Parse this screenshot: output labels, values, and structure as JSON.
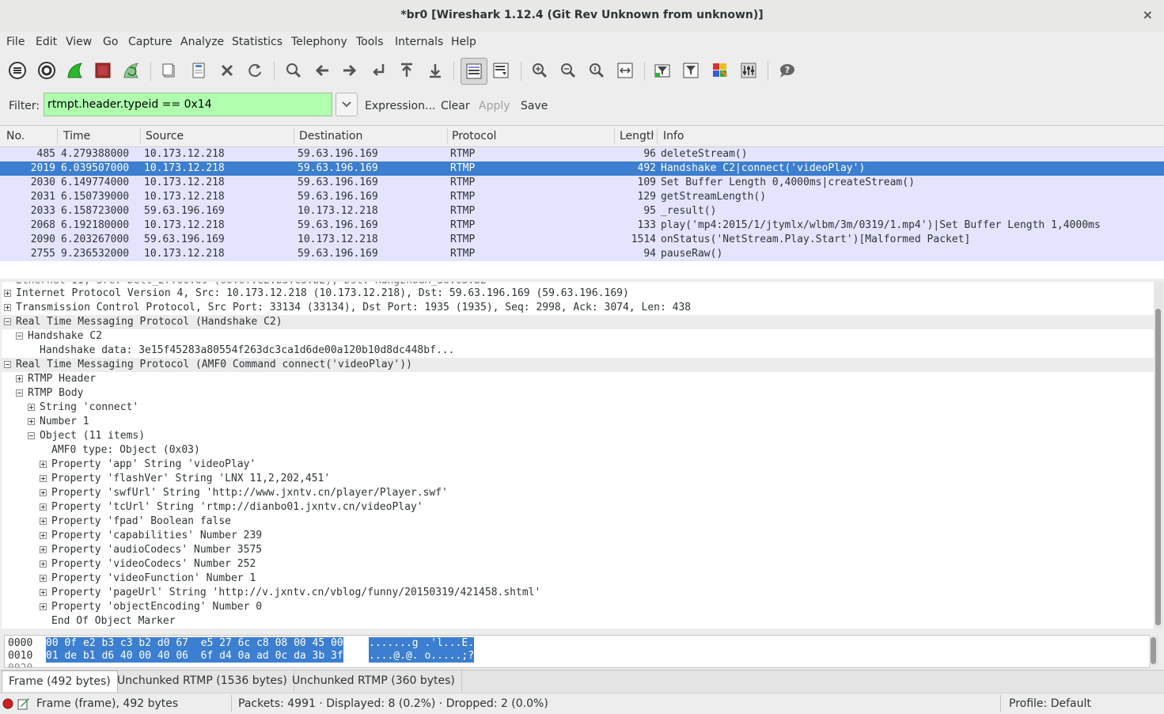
{
  "window": {
    "title": "*br0  [Wireshark 1.12.4  (Git Rev Unknown from unknown)]",
    "close": "×"
  },
  "menu": [
    "File",
    "Edit",
    "View",
    "Go",
    "Capture",
    "Analyze",
    "Statistics",
    "Telephony",
    "Tools",
    "Internals",
    "Help"
  ],
  "filter": {
    "label": "Filter:",
    "value": "rtmpt.header.typeid == 0x14",
    "expression": "Expression...",
    "clear": "Clear",
    "apply": "Apply",
    "save": "Save"
  },
  "packet_list": {
    "columns": [
      "No.",
      "Time",
      "Source",
      "Destination",
      "Protocol",
      "Length",
      "Info"
    ],
    "rows": [
      {
        "no": "485",
        "time": "4.279388000",
        "src": "10.173.12.218",
        "dst": "59.63.196.169",
        "proto": "RTMP",
        "len": "96",
        "info": "deleteStream()"
      },
      {
        "no": "2019",
        "time": "6.039507000",
        "src": "10.173.12.218",
        "dst": "59.63.196.169",
        "proto": "RTMP",
        "len": "492",
        "info": "Handshake C2|connect('videoPlay')"
      },
      {
        "no": "2030",
        "time": "6.149774000",
        "src": "10.173.12.218",
        "dst": "59.63.196.169",
        "proto": "RTMP",
        "len": "109",
        "info": "Set Buffer Length 0,4000ms|createStream()"
      },
      {
        "no": "2031",
        "time": "6.150739000",
        "src": "10.173.12.218",
        "dst": "59.63.196.169",
        "proto": "RTMP",
        "len": "129",
        "info": "getStreamLength()"
      },
      {
        "no": "2033",
        "time": "6.158723000",
        "src": "59.63.196.169",
        "dst": "10.173.12.218",
        "proto": "RTMP",
        "len": "95",
        "info": "_result()"
      },
      {
        "no": "2068",
        "time": "6.192180000",
        "src": "10.173.12.218",
        "dst": "59.63.196.169",
        "proto": "RTMP",
        "len": "133",
        "info": "play('mp4:2015/1/jtymlx/wlbm/3m/0319/1.mp4')|Set Buffer Length 1,4000ms"
      },
      {
        "no": "2090",
        "time": "6.203267000",
        "src": "59.63.196.169",
        "dst": "10.173.12.218",
        "proto": "RTMP",
        "len": "1514",
        "info": "onStatus('NetStream.Play.Start')[Malformed Packet]"
      },
      {
        "no": "2755",
        "time": "9.236532000",
        "src": "10.173.12.218",
        "dst": "59.63.196.169",
        "proto": "RTMP",
        "len": "94",
        "info": "pauseRaw()"
      }
    ]
  },
  "details": [
    {
      "text": "Internet Protocol Version 4, Src: 10.173.12.218 (10.173.12.218), Dst: 59.63.196.169 (59.63.196.169)",
      "indent": 0,
      "exp": "plus",
      "hl": false
    },
    {
      "text": "Transmission Control Protocol, Src Port: 33134 (33134), Dst Port: 1935 (1935), Seq: 2998, Ack: 3074, Len: 438",
      "indent": 0,
      "exp": "plus",
      "hl": false
    },
    {
      "text": "Real Time Messaging Protocol (Handshake C2)",
      "indent": 0,
      "exp": "minus",
      "hl": true
    },
    {
      "text": "Handshake C2",
      "indent": 1,
      "exp": "minus",
      "hl": false
    },
    {
      "text": "Handshake data: 3e15f45283a80554f263dc3ca1d6de00a120b10d8dc448bf...",
      "indent": 2,
      "exp": "none",
      "hl": false
    },
    {
      "text": "Real Time Messaging Protocol (AMF0 Command connect('videoPlay'))",
      "indent": 0,
      "exp": "minus",
      "hl": true
    },
    {
      "text": "RTMP Header",
      "indent": 1,
      "exp": "plus",
      "hl": false
    },
    {
      "text": "RTMP Body",
      "indent": 1,
      "exp": "minus",
      "hl": false
    },
    {
      "text": "String 'connect'",
      "indent": 2,
      "exp": "plus",
      "hl": false
    },
    {
      "text": "Number 1",
      "indent": 2,
      "exp": "plus",
      "hl": false
    },
    {
      "text": "Object (11 items)",
      "indent": 2,
      "exp": "minus",
      "hl": false
    },
    {
      "text": "AMF0 type: Object (0x03)",
      "indent": 3,
      "exp": "none",
      "hl": false
    },
    {
      "text": "Property 'app' String 'videoPlay'",
      "indent": 3,
      "exp": "plus",
      "hl": false
    },
    {
      "text": "Property 'flashVer' String 'LNX 11,2,202,451'",
      "indent": 3,
      "exp": "plus",
      "hl": false
    },
    {
      "text": "Property 'swfUrl' String 'http://www.jxntv.cn/player/Player.swf'",
      "indent": 3,
      "exp": "plus",
      "hl": false
    },
    {
      "text": "Property 'tcUrl' String 'rtmp://dianbo01.jxntv.cn/videoPlay'",
      "indent": 3,
      "exp": "plus",
      "hl": false
    },
    {
      "text": "Property 'fpad' Boolean false",
      "indent": 3,
      "exp": "plus",
      "hl": false
    },
    {
      "text": "Property 'capabilities' Number 239",
      "indent": 3,
      "exp": "plus",
      "hl": false
    },
    {
      "text": "Property 'audioCodecs' Number 3575",
      "indent": 3,
      "exp": "plus",
      "hl": false
    },
    {
      "text": "Property 'videoCodecs' Number 252",
      "indent": 3,
      "exp": "plus",
      "hl": false
    },
    {
      "text": "Property 'videoFunction' Number 1",
      "indent": 3,
      "exp": "plus",
      "hl": false
    },
    {
      "text": "Property 'pageUrl' String 'http://v.jxntv.cn/vblog/funny/20150319/421458.shtml'",
      "indent": 3,
      "exp": "plus",
      "hl": false
    },
    {
      "text": "Property 'objectEncoding' Number 0",
      "indent": 3,
      "exp": "plus",
      "hl": false
    },
    {
      "text": "End Of Object Marker",
      "indent": 3,
      "exp": "none",
      "hl": false
    }
  ],
  "hex": [
    {
      "offset": "0000",
      "bytes": "00 0f e2 b3 c3 b2 d0 67  e5 27 6c c8 08 00 45 00",
      "ascii": ".......g .'l...E."
    },
    {
      "offset": "0010",
      "bytes": "01 de b1 d6 40 00 40 06  6f d4 0a ad 0c da 3b 3f",
      "ascii": "....@.@. o.....;?"
    }
  ],
  "tabs": [
    "Frame (492 bytes)",
    "Unchunked RTMP (1536 bytes)",
    "Unchunked RTMP (360 bytes)"
  ],
  "status": {
    "frame": "Frame (frame), 492 bytes",
    "packets": "Packets: 4991 · Displayed: 8 (0.2%)  · Dropped: 2 (0.0%)",
    "profile": "Profile: Default"
  },
  "colors": {
    "selected_row": "#3c7ed0",
    "row_bg": "#e4e4fe",
    "filter_ok": "#afffaf",
    "status_red": "#cc2222"
  }
}
